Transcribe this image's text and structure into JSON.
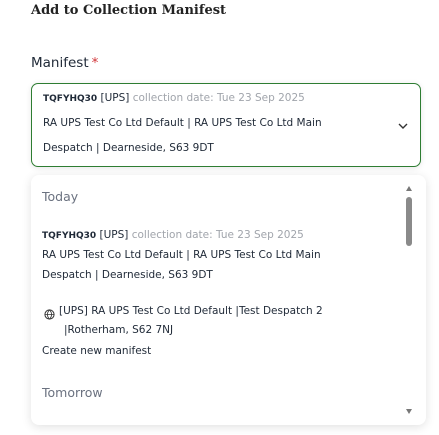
{
  "dialog": {
    "title": "Add to Collection Manifest"
  },
  "manifest_field": {
    "label": "Manifest",
    "required_marker": "*",
    "selected": {
      "code": "TQFYHQ30",
      "carrier": "[UPS]",
      "date_label": "collection date: Tue 23 Sep 2025",
      "line2": "RA UPS Test Co Ltd Default | RA UPS Test Co Ltd Main",
      "line3": "Despatch | Dearneside, S63 9DT"
    }
  },
  "dropdown": {
    "groups": [
      {
        "label": "Today"
      },
      {
        "label": "Tomorrow"
      }
    ],
    "today_item": {
      "code": "TQFYHQ30",
      "carrier": "[UPS]",
      "date_label": "collection date: Tue 23 Sep 2025",
      "line2": "RA UPS Test Co Ltd Default | RA UPS Test Co Ltd Main",
      "line3": "Despatch | Dearneside, S63 9DT"
    },
    "new_manifest": {
      "line1": "[UPS] RA UPS Test Co Ltd Default |Test Despatch 2",
      "line2": "|Rotherham, S62 7NJ",
      "line3": "Create new manifest"
    }
  },
  "icons": {
    "chevron": "chevron-down-icon",
    "globe": "globe-icon",
    "scroll_up": "scroll-up-arrow-icon",
    "scroll_down": "scroll-down-arrow-icon"
  },
  "colors": {
    "focus_border": "#2e7d32",
    "required": "#d13438",
    "muted": "#a0a4ab"
  }
}
